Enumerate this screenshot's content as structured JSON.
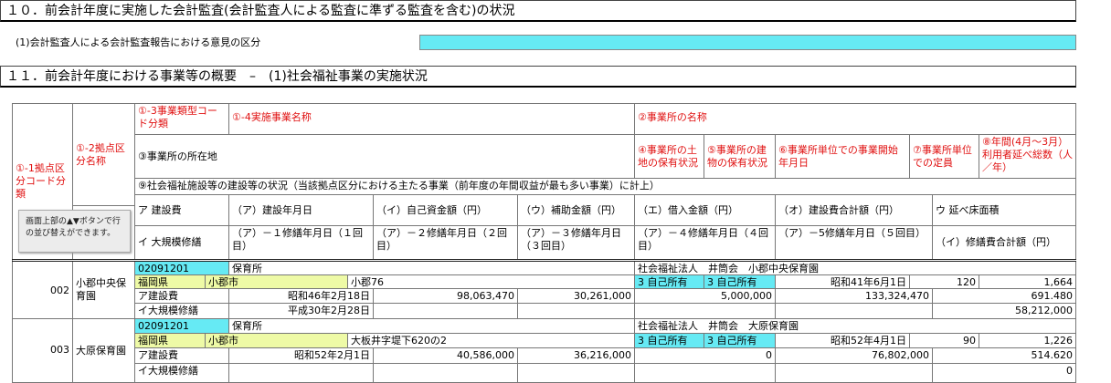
{
  "section10": {
    "title": "１０．前会計年度に実施した会計監査(会計監査人による監査に準ずる監査を含む)の状況",
    "item1_label": "(1)会計監査人による会計監査報告における意見の区分"
  },
  "section11": {
    "title": "１１．前会計年度における事業等の概要　–　(1)社会福祉事業の実施状況"
  },
  "headers": {
    "base_code": "①-1拠点区分コード分類",
    "base_name": "①-2拠点区分名称",
    "type_code": "①-3事業類型コード分類",
    "project_name": "①-4実施事業名称",
    "facility_name": "②事業所の名称",
    "address": "③事業所の所在地",
    "land": "④事業所の土地の保有状況",
    "building": "⑤事業所の建物の保有状況",
    "start_date": "⑥事業所単位での事業開始年月日",
    "capacity": "⑦事業所単位での定員",
    "annual_users": "⑧年間(4月～3月）利用者延べ総数（人／年）",
    "construction_status": "⑨社会福祉施設等の建設等の状況（当該拠点区分における主たる事業（前年度の年間収益が最も多い事業）に計上）",
    "a_cost": "ア 建設費",
    "a_date": "（ア）建設年月日",
    "b_own": "（イ）自己資金額（円）",
    "c_subsidy": "（ウ）補助金額（円）",
    "d_loan": "（エ）借入金額（円）",
    "e_total": "（オ）建設費合計額（円）",
    "u_floor": "ウ 延べ床面積",
    "i_repair": "イ 大規模修繕",
    "r1": "（ア）－１修繕年月日（１回目）",
    "r2": "（ア）－２修繕年月日（２回目）",
    "r3": "（ア）－３修繕年月日（３回目）",
    "r4": "（ア）－４修繕年月日（４回目）",
    "r5": "（ア）－5修繕年月日（５回目）",
    "i_total": "（イ）修繕費合計額（円）"
  },
  "sort_note": "画面上部の▲▼ボタンで行の並び替えができます。",
  "rows": [
    {
      "code": "002",
      "name": "小郡中央保育園",
      "type_code": "02091201",
      "project": "保育所",
      "facility": "社会福祉法人　井筒会　小郡中央保育園",
      "pref": "福岡県",
      "city": "小郡市",
      "addr": "小郡76",
      "land": "3 自己所有",
      "building": "3 自己所有",
      "start": "昭和41年6月1日",
      "capacity": "120",
      "users": "1,664",
      "a_label": "ア建設費",
      "a_date": "昭和46年2月18日",
      "own": "98,063,470",
      "subsidy": "30,261,000",
      "loan": "5,000,000",
      "total": "133,324,470",
      "floor": "691.480",
      "i_label": "イ大規模修繕",
      "repair1": "平成30年2月28日",
      "repair_total": "58,212,000"
    },
    {
      "code": "003",
      "name": "大原保育園",
      "type_code": "02091201",
      "project": "保育所",
      "facility": "社会福祉法人　井筒会　大原保育園",
      "pref": "福岡県",
      "city": "小郡市",
      "addr": "大板井字堤下620の2",
      "land": "3 自己所有",
      "building": "3 自己所有",
      "start": "昭和52年4月1日",
      "capacity": "90",
      "users": "1,226",
      "a_label": "ア建設費",
      "a_date": "昭和52年2月1日",
      "own": "40,586,000",
      "subsidy": "36,216,000",
      "loan": "0",
      "total": "76,802,000",
      "floor": "514.620",
      "i_label": "イ大規模修繕",
      "repair1": "",
      "repair_total": "0"
    }
  ]
}
